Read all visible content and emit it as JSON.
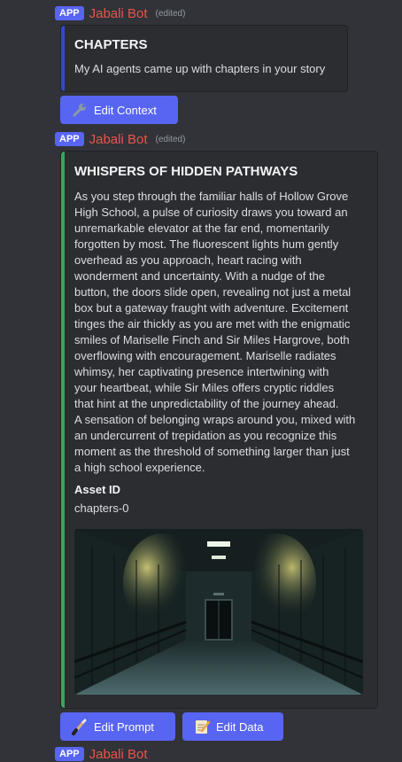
{
  "messages": [
    {
      "badge": "APP",
      "author": "Jabali Bot",
      "edited": "(edited)",
      "embed": {
        "title": "CHAPTERS",
        "description": "My AI agents came up with chapters in your story",
        "accent_color": "#2f49d1"
      },
      "buttons": [
        {
          "label": "Edit Context",
          "icon": "wrench-icon"
        }
      ]
    },
    {
      "badge": "APP",
      "author": "Jabali Bot",
      "edited": "(edited)",
      "embed": {
        "title": "WHISPERS OF HIDDEN PATHWAYS",
        "description_lines": [
          "As you step through the familiar halls of Hollow Grove",
          "High School, a pulse of curiosity draws you toward an",
          "unremarkable elevator at the far end, momentarily",
          "forgotten by most. The fluorescent lights hum gently",
          "overhead as you approach, heart racing with",
          "wonderment and uncertainty. With a nudge of the",
          "button, the doors slide open, revealing not just a metal",
          "box but a gateway fraught with adventure. Excitement",
          "tinges the air thickly as you are met with the enigmatic",
          "smiles of Mariselle Finch and Sir Miles Hargrove, both",
          "overflowing with encouragement. Mariselle radiates",
          "whimsy, her captivating presence intertwining with",
          "your heartbeat, while Sir Miles offers cryptic riddles",
          "that hint at the unpredictability of the journey ahead.",
          "A sensation of belonging wraps around you, mixed with",
          "an undercurrent of trepidation as you recognize this",
          "moment as the threshold of something larger than just",
          "a high school experience."
        ],
        "field_name": "Asset ID",
        "field_value": "chapters-0",
        "accent_color": "#3ba55c",
        "image_subject": "school-hallway-elevator"
      },
      "buttons": [
        {
          "label": "Edit Prompt",
          "icon": "paintbrush-icon"
        },
        {
          "label": "Edit Data",
          "icon": "memo-icon"
        }
      ]
    },
    {
      "badge": "APP",
      "author": "Jabali Bot"
    }
  ]
}
